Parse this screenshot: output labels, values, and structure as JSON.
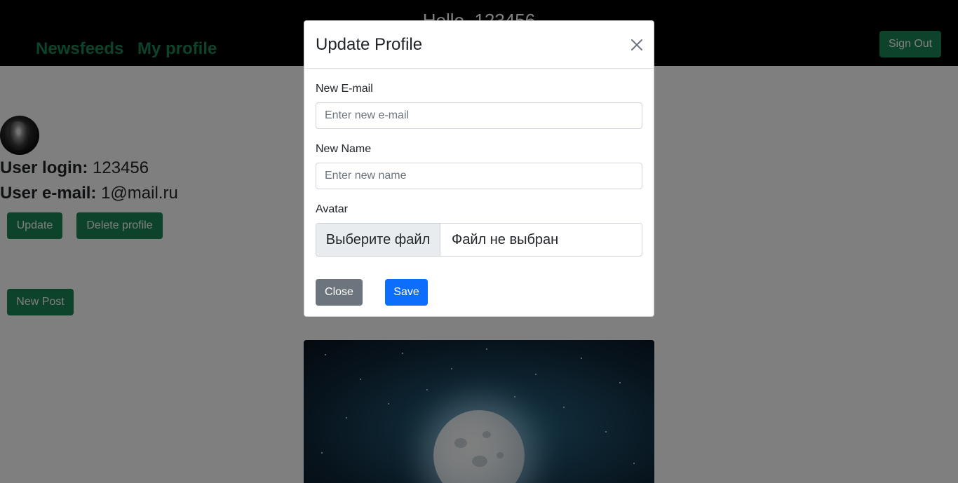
{
  "navbar": {
    "greeting": "Hello, 123456",
    "links": [
      "Newsfeeds",
      "My profile"
    ],
    "sign_out": "Sign Out"
  },
  "profile": {
    "login_label": "User login:",
    "login_value": "123456",
    "email_label": "User e-mail:",
    "email_value": "1@mail.ru",
    "update_button": "Update",
    "delete_button": "Delete profile",
    "new_post_button": "New Post"
  },
  "modal": {
    "title": "Update Profile",
    "email_label": "New E-mail",
    "email_placeholder": "Enter new e-mail",
    "name_label": "New Name",
    "name_placeholder": "Enter new name",
    "avatar_label": "Avatar",
    "file_button": "Выберите файл",
    "file_status": "Файл не выбран",
    "close_button": "Close",
    "save_button": "Save"
  },
  "colors": {
    "brand_green": "#198754",
    "primary_blue": "#0d6efd",
    "secondary_gray": "#6c757d"
  }
}
